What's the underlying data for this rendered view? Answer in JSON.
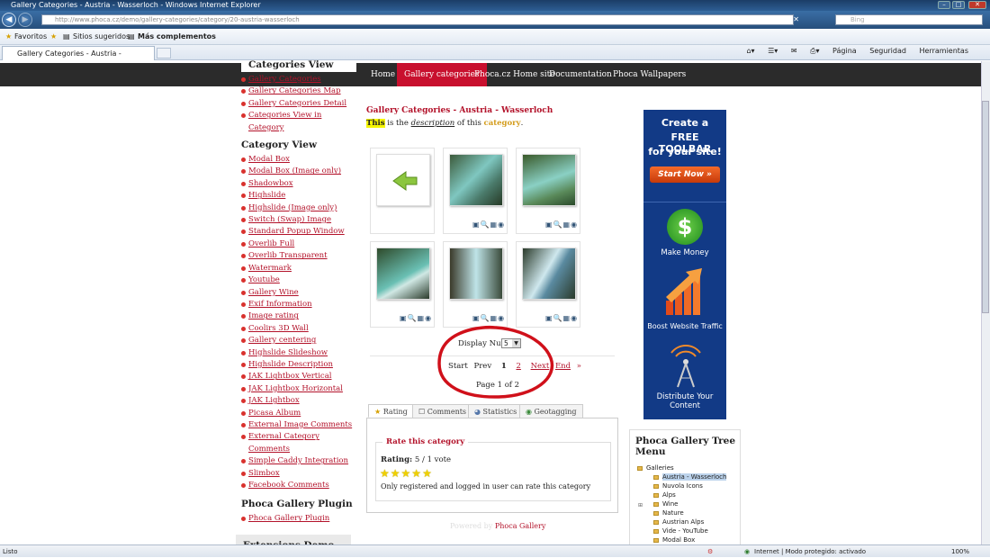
{
  "window": {
    "title": "Gallery Categories - Austria - Wasserloch - Windows Internet Explorer"
  },
  "address": {
    "url": "http://www.phoca.cz/demo/gallery-categories/category/20-austria-wasserloch",
    "search_placeholder": "Bing"
  },
  "favorites_bar": {
    "favorites": "Favoritos",
    "suggested": "Sitios sugeridos",
    "more": "Más complementos"
  },
  "tab": {
    "title": "Gallery Categories - Austria - Wasserloch"
  },
  "commandbar": {
    "page": "Página",
    "security": "Seguridad",
    "tools": "Herramientas"
  },
  "topnav": [
    "Home",
    "Gallery categories",
    "Phoca.cz Home site",
    "Documentation",
    "Phoca Wallpapers"
  ],
  "left": {
    "heading1": "Categories View",
    "links1": [
      "Gallery Categories",
      "Gallery Categories Map",
      "Gallery Categories Detail",
      "Categories View in Category"
    ],
    "heading2": "Category View",
    "links2": [
      "Modal Box",
      "Modal Box (Image only)",
      "Shadowbox",
      "Highslide",
      "Highslide (Image only)",
      "Switch (Swap) Image",
      "Standard Popup Window",
      "Overlib Full",
      "Overlib Transparent",
      "Watermark",
      "Youtube",
      "Gallery Wine",
      "Exif Information",
      "Image rating",
      "Coolirs 3D Wall",
      "Gallery centering",
      "Highslide Slideshow",
      "Highslide Description",
      "JAK Lightbox Vertical",
      "JAK Lightbox Horizontal",
      "JAK Lightbox",
      "Picasa Album",
      "External Image Comments",
      "External Category Comments",
      "Simple Caddy Integration",
      "Slimbox",
      "Facebook Comments"
    ],
    "heading3": "Phoca Gallery Plugin",
    "links3": [
      "Phoca Gallery Plugin"
    ],
    "heading4": "Extensions Demo"
  },
  "main": {
    "title": "Gallery Categories - Austria - Wasserloch",
    "desc_this": "This",
    "desc_is_the": " is the ",
    "desc_description": "description",
    "desc_of_this": " of this ",
    "desc_category": "category",
    "desc_end": ".",
    "display_num_label": "Display Num",
    "display_num_value": "5",
    "pagination": {
      "start": "Start",
      "prev": "Prev",
      "p1": "1",
      "p2": "2",
      "next": "Next",
      "end": "End",
      "arrow": "»"
    },
    "page_of": "Page 1 of 2",
    "tabs": [
      "Rating",
      "Comments",
      "Statistics",
      "Geotagging"
    ],
    "rate_title": "Rate this category",
    "rating_label": "Rating:",
    "rating_value": "5 / 1 vote",
    "rating_stars": 5,
    "rate_note": "Only registered and logged in user can rate this category",
    "powered_by": "Powered by",
    "powered_link": "Phoca Gallery"
  },
  "ad": {
    "line1": "Create a",
    "line2": "FREE TOOLBAR",
    "line3": "for your site!",
    "start": "Start Now »",
    "money": "Make Money",
    "traffic": "Boost Website Traffic",
    "distribute": "Distribute Your Content"
  },
  "tree": {
    "title": "Phoca Gallery Tree Menu",
    "root": "Galleries",
    "items": [
      "Austria - Wasserloch",
      "Nuvola Icons",
      "Alps",
      "Wine",
      "Nature",
      "Austrian Alps",
      "Vide - YouTube",
      "Modal Box"
    ]
  },
  "status": {
    "left": "Listo",
    "zone": "Internet | Modo protegido: activado",
    "zoom": "100%"
  },
  "colors": {
    "link": "#b3122a",
    "active_nav": "#c8102e",
    "category_word": "#d39b1a",
    "annotation": "#d0101a"
  }
}
